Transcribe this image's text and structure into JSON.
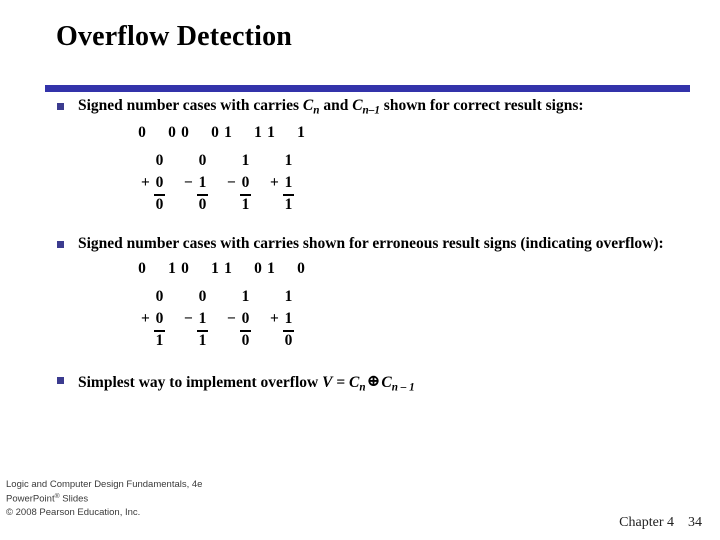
{
  "slide": {
    "title": "Overflow Detection",
    "accent_color": "#3333aa",
    "bullet_color": "#3b3b8f",
    "background": "#ffffff"
  },
  "bullets": [
    {
      "id": "correct-signs",
      "text_parts": [
        "Signed number cases with carries ",
        "C",
        "n",
        " and ",
        "C",
        "n–1",
        " shown for correct result signs:"
      ],
      "text_plain": "Signed number cases with carries Cn and Cn–1 shown for correct result signs:"
    },
    {
      "id": "erroneous-signs",
      "text_plain": "Signed number cases with carries shown for erroneous result signs (indicating overflow):"
    },
    {
      "id": "implement-overflow",
      "text_plain": "Simplest way to implement overflow V = Cn ⊕ Cn – 1",
      "lead": "Simplest way to implement overflow ",
      "v": "V",
      "eq": " = ",
      "c1": "C",
      "c1sub": "n",
      "xor": "⊕",
      "c2": "C",
      "c2sub": "n – 1"
    }
  ],
  "case_groups": [
    {
      "id": "correct-result-signs",
      "carry_label": "carry bits Cn Cn-1",
      "carry_digits": [
        "0",
        "0",
        "0",
        "0",
        "1",
        "1",
        "1",
        "1"
      ],
      "columns": [
        {
          "operand1": "0",
          "sign": "+",
          "operand2": "0",
          "result": "0"
        },
        {
          "operand1": "0",
          "sign": "−",
          "operand2": "1",
          "result": "0"
        },
        {
          "operand1": "1",
          "sign": "−",
          "operand2": "0",
          "result": "1"
        },
        {
          "operand1": "1",
          "sign": "+",
          "operand2": "1",
          "result": "1"
        }
      ]
    },
    {
      "id": "erroneous-result-signs",
      "carry_label": "carry bits Cn Cn-1",
      "carry_digits": [
        "0",
        "1",
        "0",
        "1",
        "1",
        "0",
        "1",
        "0"
      ],
      "columns": [
        {
          "operand1": "0",
          "sign": "+",
          "operand2": "0",
          "result": "1"
        },
        {
          "operand1": "0",
          "sign": "−",
          "operand2": "1",
          "result": "1"
        },
        {
          "operand1": "1",
          "sign": "−",
          "operand2": "0",
          "result": "0"
        },
        {
          "operand1": "1",
          "sign": "+",
          "operand2": "1",
          "result": "0"
        }
      ]
    }
  ],
  "footer": {
    "line1": "Logic and Computer Design Fundamentals, 4e",
    "line2_pre": "PowerPoint",
    "line2_reg": "®",
    "line2_post": " Slides",
    "line3": "© 2008 Pearson Education, Inc.",
    "chapter": "Chapter 4",
    "page": "34"
  }
}
